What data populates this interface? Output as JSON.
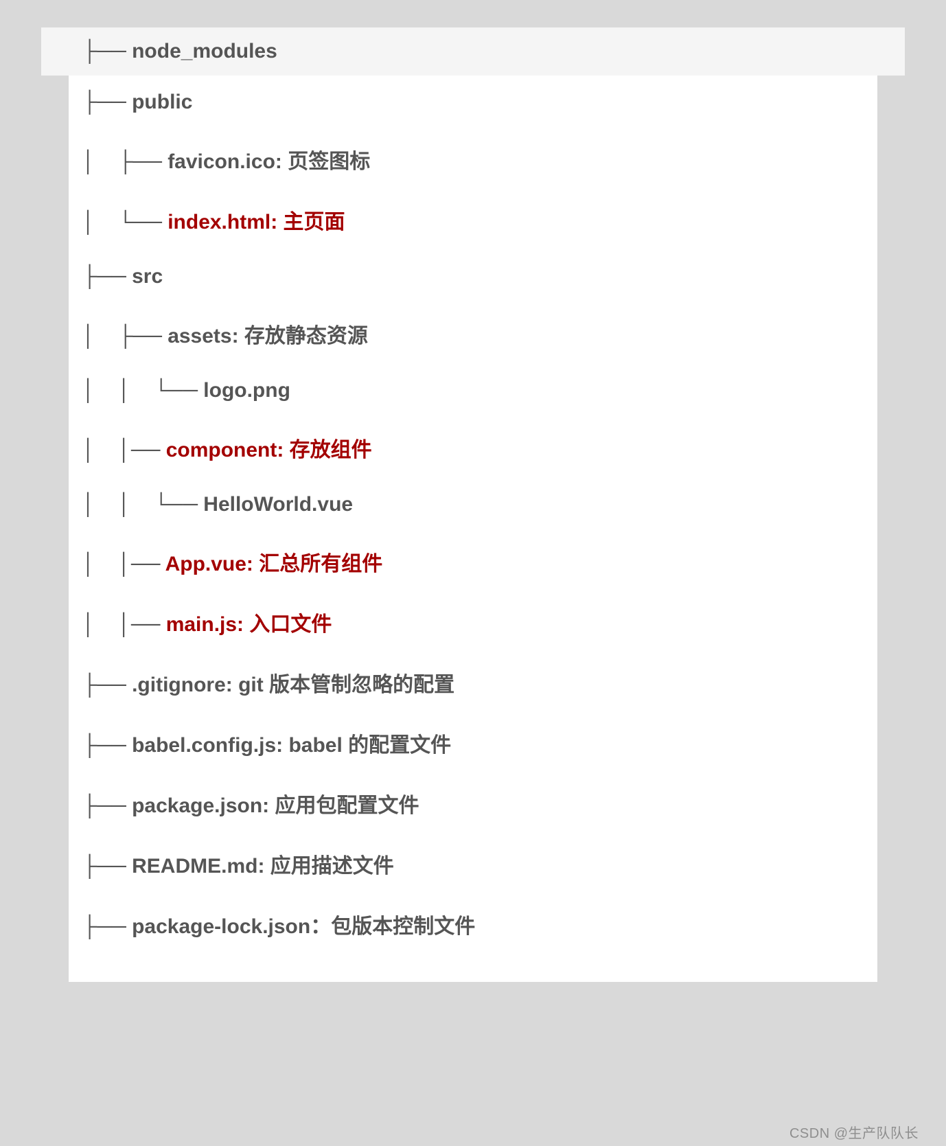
{
  "header": {
    "line": "├── node_modules"
  },
  "lines": [
    {
      "text": "├── public",
      "highlight": false
    },
    {
      "text": "│    ├── favicon.ico: 页签图标",
      "highlight": false
    },
    {
      "text": "│    └── index.html: 主页面",
      "highlight": true,
      "prefix": "│    └── "
    },
    {
      "text": "├── src",
      "highlight": false
    },
    {
      "text": "│    ├── assets: 存放静态资源",
      "highlight": false
    },
    {
      "text": "│    │    └── logo.png",
      "highlight": false
    },
    {
      "text": "│    │── component: 存放组件",
      "highlight": true,
      "prefix": "│    │── "
    },
    {
      "text": "│    │    └── HelloWorld.vue",
      "highlight": false
    },
    {
      "text": "│    │── App.vue: 汇总所有组件",
      "highlight": true,
      "prefix": "│    │── "
    },
    {
      "text": "│    │── main.js: 入口文件",
      "highlight": true,
      "prefix": "│    │── "
    },
    {
      "text": "├── .gitignore: git 版本管制忽略的配置",
      "highlight": false
    },
    {
      "text": "├── babel.config.js: babel 的配置文件",
      "highlight": false
    },
    {
      "text": "├── package.json: 应用包配置文件",
      "highlight": false
    },
    {
      "text": "├── README.md: 应用描述文件",
      "highlight": false
    },
    {
      "text": "├── package-lock.json：包版本控制文件",
      "highlight": false
    }
  ],
  "watermark": "CSDN @生产队队长"
}
